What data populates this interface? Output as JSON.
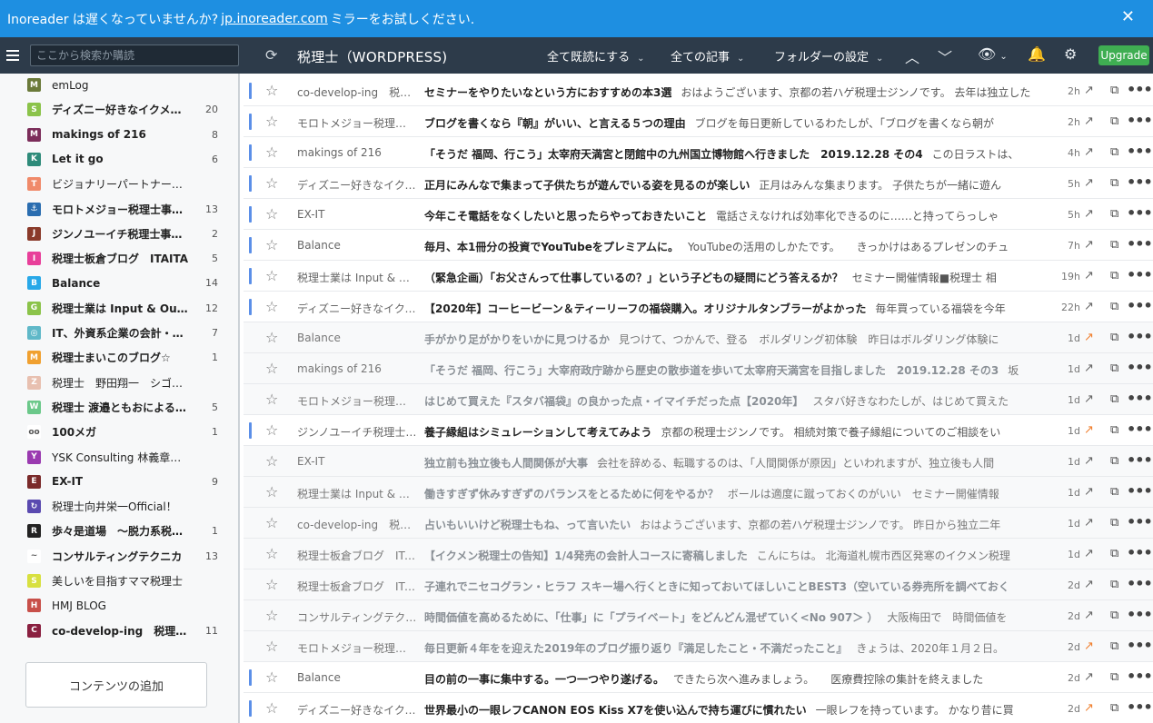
{
  "banner": {
    "text_before": "Inoreader は遅くなっていませんか?",
    "link": "jp.inoreader.com",
    "text_after": "ミラーをお試しください.",
    "close": "✕"
  },
  "topbar": {
    "search_placeholder": "ここから検索か購読",
    "feed_title": "税理士（WORDPRESS)",
    "mark_all_read": "全て既読にする",
    "all_articles": "全ての記事",
    "folder_settings": "フォルダーの設定",
    "upgrade": "Upgrade"
  },
  "sidebar": {
    "feeds": [
      {
        "name": "emLog",
        "count": "",
        "icon": "M",
        "color": "#6b7a3a",
        "bold": false
      },
      {
        "name": "ディズニー好きなイクメン税理士",
        "count": "20",
        "icon": "S",
        "color": "#8bc34a",
        "bold": true
      },
      {
        "name": "makings of 216",
        "count": "8",
        "icon": "M",
        "color": "#7b2d5a",
        "bold": true
      },
      {
        "name": "Let it go",
        "count": "6",
        "icon": "K",
        "color": "#2e8b7a",
        "bold": true
      },
      {
        "name": "ビジョナリーパートナー税理士",
        "count": "",
        "icon": "T",
        "color": "#f08a6a",
        "bold": false
      },
      {
        "name": "モロトメジョー税理士事務所",
        "count": "13",
        "icon": "⚓",
        "color": "#2a6db0",
        "bold": true
      },
      {
        "name": "ジンノユーイチ税理士事務所",
        "count": "2",
        "icon": "J",
        "color": "#8a3a2a",
        "bold": true
      },
      {
        "name": "税理士板倉ブログ　ITAITA",
        "count": "5",
        "icon": "I",
        "color": "#e83f9a",
        "bold": true
      },
      {
        "name": "Balance",
        "count": "14",
        "icon": "B",
        "color": "#28a8e8",
        "bold": true
      },
      {
        "name": "税理士業は Input & Output",
        "count": "12",
        "icon": "G",
        "color": "#8bc34a",
        "bold": true
      },
      {
        "name": "IT、外資系企業の会計・税務",
        "count": "7",
        "icon": "◎",
        "color": "#5fb8c8",
        "bold": true
      },
      {
        "name": "税理士まいこのブログ☆",
        "count": "1",
        "icon": "M",
        "color": "#f0a030",
        "bold": true
      },
      {
        "name": "税理士　野田翔一　シゴトノート",
        "count": "",
        "icon": "Z",
        "color": "#e8c0b0",
        "bold": false
      },
      {
        "name": "税理士 渡邉ともおによるブログ",
        "count": "5",
        "icon": "W",
        "color": "#6bc88a",
        "bold": true
      },
      {
        "name": "100メガ",
        "count": "1",
        "icon": "oo",
        "color": "#ffffff",
        "bold": true
      },
      {
        "name": "YSK Consulting 林義章税理士",
        "count": "",
        "icon": "Y",
        "color": "#9a3ab0",
        "bold": false
      },
      {
        "name": "EX-IT",
        "count": "9",
        "icon": "E",
        "color": "#7a2a2a",
        "bold": true
      },
      {
        "name": "税理士向井栄一Official！",
        "count": "",
        "icon": "↻",
        "color": "#5a4ab0",
        "bold": false
      },
      {
        "name": "歩々是道場　〜脱力系税理士",
        "count": "1",
        "icon": "R",
        "color": "#222222",
        "bold": true
      },
      {
        "name": "コンサルティングテクニカ",
        "count": "13",
        "icon": "~",
        "color": "#ffffff",
        "bold": true
      },
      {
        "name": "美しいを目指すママ税理士",
        "count": "",
        "icon": "S",
        "color": "#d8e040",
        "bold": false
      },
      {
        "name": "HMJ BLOG",
        "count": "",
        "icon": "H",
        "color": "#c8504a",
        "bold": false
      },
      {
        "name": "co-develop-ing　税理士ジンノ",
        "count": "11",
        "icon": "C",
        "color": "#8a2040",
        "bold": true
      }
    ],
    "add_content": "コンテンツの追加"
  },
  "articles": [
    {
      "source": "co-develop-ing　税理士",
      "title": "セミナーをやりたいなという方におすすめの本3選",
      "summary": "おはようございます、京都の若ハゲ税理士ジンノです。 去年は独立した",
      "time": "2h",
      "unread": true,
      "hot": false
    },
    {
      "source": "モロトメジョー税理士事務所",
      "title": "ブログを書くなら『朝』がいい、と言える５つの理由",
      "summary": "ブログを毎日更新しているわたしが、「ブログを書くなら朝が",
      "time": "2h",
      "unread": true,
      "hot": false
    },
    {
      "source": "makings of 216",
      "title": "「そうだ 福岡、行こう」太宰府天満宮と閉館中の九州国立博物館へ行きました　2019.12.28 その4",
      "summary": "この日ラストは、",
      "time": "4h",
      "unread": true,
      "hot": false
    },
    {
      "source": "ディズニー好きなイクメン税理士",
      "title": "正月にみんなで集まって子供たちが遊んでいる姿を見るのが楽しい",
      "summary": "正月はみんな集まります。 子供たちが一緒に遊ん",
      "time": "5h",
      "unread": true,
      "hot": false
    },
    {
      "source": "EX-IT",
      "title": "今年こそ電話をなくしたいと思ったらやっておきたいこと",
      "summary": "電話さえなければ効率化できるのに……と持ってらっしゃ",
      "time": "5h",
      "unread": true,
      "hot": false
    },
    {
      "source": "Balance",
      "title": "毎月、本1冊分の投資でYouTubeをプレミアムに。",
      "summary": "YouTubeの活用のしかたです。　　きっかけはあるプレゼンのチュ",
      "time": "7h",
      "unread": true,
      "hot": false
    },
    {
      "source": "税理士業は Input & Output",
      "title": "（緊急企画）「お父さんって仕事しているの？」という子どもの疑問にどう答えるか？",
      "summary": "セミナー開催情報■税理士 相",
      "time": "19h",
      "unread": true,
      "hot": false
    },
    {
      "source": "ディズニー好きなイクメン税理士",
      "title": "【2020年】コーヒービーン＆ティーリーフの福袋購入。オリジナルタンブラーがよかった",
      "summary": "毎年買っている福袋を今年",
      "time": "22h",
      "unread": true,
      "hot": false
    },
    {
      "source": "Balance",
      "title": "手がかり足がかりをいかに見つけるか",
      "summary": "見つけて、つかんで、登る　ボルダリング初体験　昨日はボルダリング体験に",
      "time": "1d",
      "unread": false,
      "hot": true
    },
    {
      "source": "makings of 216",
      "title": "「そうだ 福岡、行こう」大宰府政庁跡から歴史の散歩道を歩いて太宰府天満宮を目指しました　2019.12.28 その3",
      "summary": "坂",
      "time": "1d",
      "unread": false,
      "hot": false
    },
    {
      "source": "モロトメジョー税理士事務所",
      "title": "はじめて買えた『スタバ福袋』の良かった点・イマイチだった点【2020年】",
      "summary": "スタバ好きなわたしが、はじめて買えた",
      "time": "1d",
      "unread": false,
      "hot": false
    },
    {
      "source": "ジンノユーイチ税理士事務所",
      "title": "養子縁組はシミュレーションして考えてみよう",
      "summary": "京都の税理士ジンノです。 相続対策で養子縁組についてのご相談をい",
      "time": "1d",
      "unread": true,
      "hot": true
    },
    {
      "source": "EX-IT",
      "title": "独立前も独立後も人間関係が大事",
      "summary": "会社を辞める、転職するのは、「人間関係が原因」といわれますが、独立後も人間",
      "time": "1d",
      "unread": false,
      "hot": false
    },
    {
      "source": "税理士業は Input & Output",
      "title": "働きすぎず休みすぎずのバランスをとるために何をやるか？",
      "summary": "ボールは適度に蹴っておくのがいい　セミナー開催情報",
      "time": "1d",
      "unread": false,
      "hot": false
    },
    {
      "source": "co-develop-ing　税理士",
      "title": "占いもいいけど税理士もね、って言いたい",
      "summary": "おはようございます、京都の若ハゲ税理士ジンノです。 昨日から独立二年",
      "time": "1d",
      "unread": false,
      "hot": false
    },
    {
      "source": "税理士板倉ブログ　ITAITA",
      "title": "【イクメン税理士の告知】1/4発売の会計人コースに寄稿しました",
      "summary": "こんにちは。 北海道札幌市西区発寒のイクメン税理",
      "time": "1d",
      "unread": false,
      "hot": false
    },
    {
      "source": "税理士板倉ブログ　ITAITA",
      "title": "子連れでニセコグラン・ヒラフ スキー場へ行くときに知っておいてほしいことBEST3（空いている券売所を調べておく",
      "summary": "",
      "time": "2d",
      "unread": false,
      "hot": false
    },
    {
      "source": "コンサルティングテクニカ",
      "title": "時間価値を高めるために、「仕事」に「プライベート」をどんどん混ぜていく<No 907＞ ）",
      "summary": "大阪梅田で　時間価値を",
      "time": "2d",
      "unread": false,
      "hot": false
    },
    {
      "source": "モロトメジョー税理士事務所",
      "title": "毎日更新４年をを迎えた2019年のブログ振り返り『満足したこと・不満だったこと』",
      "summary": "きょうは、2020年１月２日。",
      "time": "2d",
      "unread": false,
      "hot": true
    },
    {
      "source": "Balance",
      "title": "目の前の一事に集中する。一つ一つやり遂げる。",
      "summary": "できたら次へ進みましょう。　　医療費控除の集計を終えました",
      "time": "2d",
      "unread": true,
      "hot": false
    },
    {
      "source": "ディズニー好きなイクメン税理士",
      "title": "世界最小の一眼レフCANON EOS Kiss X7を使い込んで持ち運びに慣れたい",
      "summary": "一眼レフを持っています。 かなり昔に買",
      "time": "2d",
      "unread": true,
      "hot": true
    }
  ]
}
